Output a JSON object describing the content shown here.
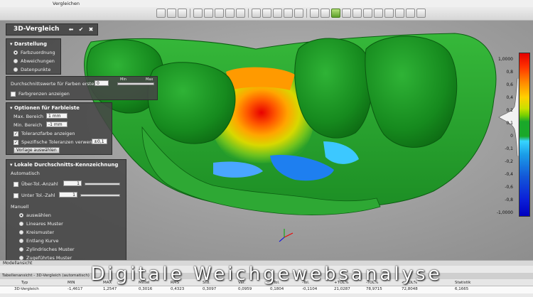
{
  "menu": {
    "vergleichen": "Vergleichen"
  },
  "toolbar": {
    "active_index": 15
  },
  "dialog": {
    "title": "3D-Vergleich",
    "darstellung": {
      "header": "Darstellung",
      "options": [
        "Farbzuordnung",
        "Abweichungen",
        "Datenpunkte"
      ],
      "selected": 0
    },
    "durchschnitt": {
      "label": "Durchschnittswerte für Farben erstellen",
      "value": "0",
      "min_label": "Min",
      "max_label": "Max",
      "farbgrenzen_label": "Farbgrenzen anzeigen"
    },
    "farbleiste": {
      "header": "Optionen für Farbleiste",
      "max_label": "Max. Bereich",
      "max_value": "1 mm",
      "min_label": "Min. Bereich",
      "min_value": "-1 mm",
      "toleranzfarbe_label": "Toleranzfarbe anzeigen",
      "spezifisch_label": "Spezifische Toleranzen verwenden",
      "spezifisch_value": "±0,1",
      "vorlage_button": "Vorlage auswählen"
    },
    "lokale": {
      "header": "Lokale Durchschnitts-Kennzeichnung",
      "automatisch": "Automatisch",
      "ueber_label": "Über-Tol.-Anzahl",
      "ueber_value": "1",
      "unter_label": "Unter Tol.-Zahl",
      "unter_value": "1",
      "manuell": "Manuell",
      "manuell_options": [
        "auswählen",
        "Lineares Muster",
        "Kreismuster",
        "Entlang Kurve",
        "Zylindrisches Muster",
        "Zugeführtes Muster"
      ],
      "manuell_selected": 0
    }
  },
  "colorbar": {
    "labels": [
      "1,0000",
      "0,8",
      "0,6",
      "0,4",
      "0,2",
      "0,1",
      "0",
      "-0,1",
      "-0,2",
      "-0,4",
      "-0,6",
      "-0,8",
      "-1,0000"
    ]
  },
  "bottom": {
    "modellansicht": "Modellansicht",
    "tab": "Tabellenansicht - 3D-Vergleich (automatisch)",
    "headers": [
      "Typ",
      "MIN",
      "MAX",
      "Mittel",
      "RMS",
      "Std.",
      "Var.",
      "+Tol.",
      "-Tol.",
      "+TOL%",
      "-TOL%",
      "<-TOL%",
      "Statistik"
    ],
    "row": [
      "3D-Vergleich",
      "-1,4617",
      "1,2547",
      "0,3016",
      "0,4323",
      "0,3097",
      "0,0959",
      "0,1804",
      "-0,1104",
      "21,0287",
      "78,9715",
      "72,8048",
      "6,1665"
    ]
  },
  "caption": "Digitale Weichgewebsanalyse"
}
